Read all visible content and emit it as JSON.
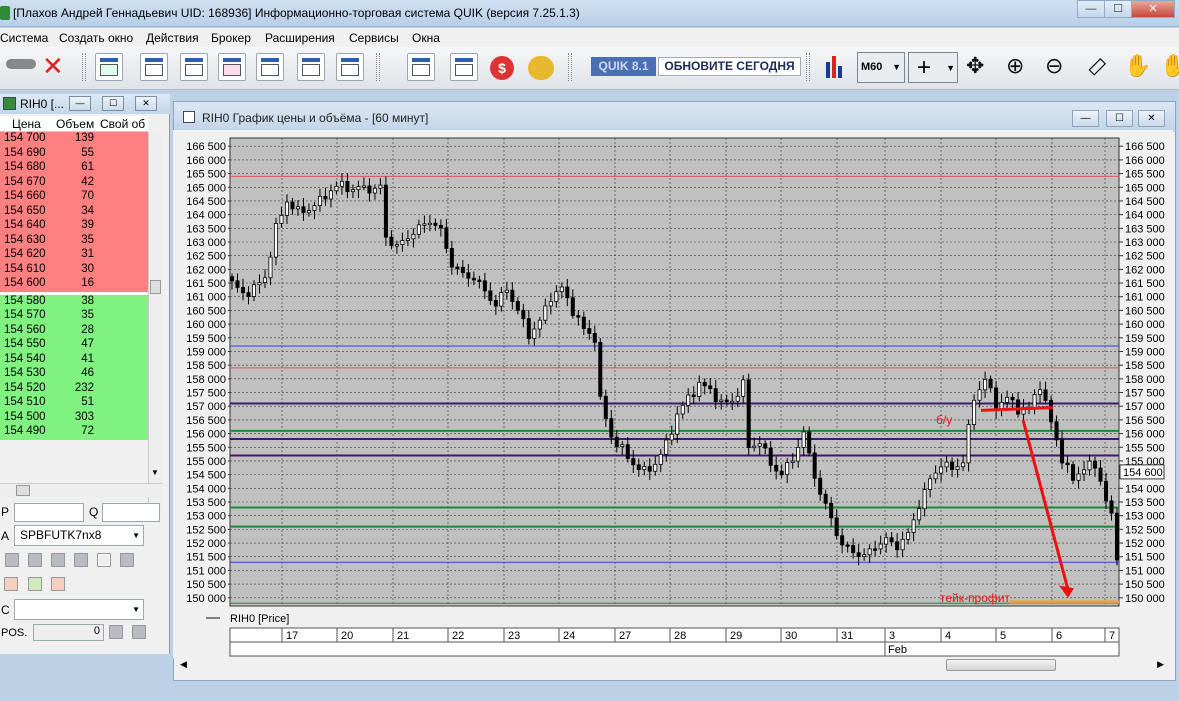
{
  "window": {
    "title": "[Плахов Андрей Геннадьевич UID: 168936] Информационно-торговая система QUIK (версия 7.25.1.3)",
    "controls": [
      "—",
      "☐",
      "✕"
    ]
  },
  "menu": [
    "Система",
    "Создать окно",
    "Действия",
    "Брокер",
    "Расширения",
    "Сервисы",
    "Окна"
  ],
  "toolbar": {
    "badge": "QUIK 8.1",
    "update_text": "ОБНОВИТЕ СЕГОДНЯ",
    "interval": "M60"
  },
  "orderbook": {
    "title": "RIH0 [...",
    "columns": [
      "Цена",
      "Объем",
      "Свой об"
    ],
    "sell": [
      [
        "154 700",
        "139"
      ],
      [
        "154 690",
        "55"
      ],
      [
        "154 680",
        "61"
      ],
      [
        "154 670",
        "42"
      ],
      [
        "154 660",
        "70"
      ],
      [
        "154 650",
        "34"
      ],
      [
        "154 640",
        "39"
      ],
      [
        "154 630",
        "35"
      ],
      [
        "154 620",
        "31"
      ],
      [
        "154 610",
        "30"
      ],
      [
        "154 600",
        "16"
      ]
    ],
    "buy": [
      [
        "154 580",
        "38"
      ],
      [
        "154 570",
        "35"
      ],
      [
        "154 560",
        "28"
      ],
      [
        "154 550",
        "47"
      ],
      [
        "154 540",
        "41"
      ],
      [
        "154 530",
        "46"
      ],
      [
        "154 520",
        "232"
      ],
      [
        "154 510",
        "51"
      ],
      [
        "154 500",
        "303"
      ],
      [
        "154 490",
        "72"
      ]
    ],
    "label_p": "P",
    "label_q": "Q",
    "label_a": "A",
    "account": "SPBFUTK7nx8",
    "label_c": "C",
    "label_pos": "POS.",
    "pos_value": "0"
  },
  "chart_window": {
    "title": "RIH0 График цены и объёма - [60 минут]",
    "legend": "RIH0 [Price]",
    "month_label": "Feb",
    "current_price": "154 600",
    "annotation_be": "б/у",
    "annotation_tp": "тейк-профит"
  },
  "chart_data": {
    "type": "candlestick",
    "ylim": [
      149700,
      166800
    ],
    "y_ticks": [
      150000,
      150500,
      151000,
      151500,
      152000,
      152500,
      153000,
      153500,
      154000,
      154500,
      155000,
      155500,
      156000,
      156500,
      157000,
      157500,
      158000,
      158500,
      159000,
      159500,
      160000,
      160500,
      161000,
      161500,
      162000,
      162500,
      163000,
      163500,
      164000,
      164500,
      165000,
      165500,
      166000,
      166500
    ],
    "x_labels": [
      "17",
      "20",
      "21",
      "22",
      "23",
      "24",
      "27",
      "28",
      "29",
      "30",
      "31",
      "3",
      "4",
      "5",
      "6",
      "7"
    ],
    "close_path": [
      [
        0,
        161500
      ],
      [
        2,
        161100
      ],
      [
        4,
        161300
      ],
      [
        6,
        161700
      ],
      [
        8,
        163500
      ],
      [
        10,
        164500
      ],
      [
        12,
        164100
      ],
      [
        14,
        164200
      ],
      [
        16,
        164500
      ],
      [
        18,
        164900
      ],
      [
        20,
        165100
      ],
      [
        22,
        164900
      ],
      [
        24,
        165000
      ],
      [
        26,
        164900
      ],
      [
        27,
        165000
      ],
      [
        28,
        163200
      ],
      [
        30,
        162800
      ],
      [
        32,
        163200
      ],
      [
        34,
        163500
      ],
      [
        36,
        163800
      ],
      [
        38,
        163400
      ],
      [
        40,
        162200
      ],
      [
        42,
        161800
      ],
      [
        44,
        161700
      ],
      [
        46,
        161200
      ],
      [
        48,
        160700
      ],
      [
        50,
        161300
      ],
      [
        52,
        160500
      ],
      [
        54,
        159600
      ],
      [
        56,
        160100
      ],
      [
        58,
        161000
      ],
      [
        60,
        161300
      ],
      [
        62,
        160500
      ],
      [
        64,
        159800
      ],
      [
        66,
        159500
      ],
      [
        67,
        157200
      ],
      [
        69,
        155900
      ],
      [
        71,
        155400
      ],
      [
        73,
        154900
      ],
      [
        75,
        154600
      ],
      [
        77,
        154900
      ],
      [
        79,
        155600
      ],
      [
        81,
        156700
      ],
      [
        83,
        157300
      ],
      [
        85,
        157800
      ],
      [
        87,
        157600
      ],
      [
        89,
        157100
      ],
      [
        91,
        157200
      ],
      [
        93,
        157800
      ],
      [
        94,
        155500
      ],
      [
        96,
        155700
      ],
      [
        98,
        154900
      ],
      [
        100,
        154500
      ],
      [
        102,
        155100
      ],
      [
        104,
        156000
      ],
      [
        105,
        155200
      ],
      [
        107,
        153800
      ],
      [
        109,
        152900
      ],
      [
        111,
        151900
      ],
      [
        113,
        151700
      ],
      [
        115,
        151500
      ],
      [
        117,
        151900
      ],
      [
        119,
        152100
      ],
      [
        121,
        151900
      ],
      [
        123,
        152300
      ],
      [
        125,
        153400
      ],
      [
        127,
        154300
      ],
      [
        129,
        154900
      ],
      [
        131,
        154700
      ],
      [
        133,
        155000
      ],
      [
        135,
        157300
      ],
      [
        137,
        158000
      ],
      [
        139,
        157000
      ],
      [
        141,
        157300
      ],
      [
        143,
        156900
      ],
      [
        145,
        156900
      ],
      [
        147,
        157800
      ],
      [
        149,
        156400
      ],
      [
        151,
        155100
      ],
      [
        153,
        154300
      ],
      [
        155,
        154800
      ],
      [
        157,
        154800
      ],
      [
        158,
        154300
      ],
      [
        160,
        152900
      ],
      [
        161,
        151500
      ]
    ],
    "levels": [
      {
        "price": 165400,
        "color": "#e05555",
        "width": 1
      },
      {
        "price": 159200,
        "color": "#3a3aee",
        "width": 1
      },
      {
        "price": 158400,
        "color": "#e05555",
        "width": 1
      },
      {
        "price": 157100,
        "color": "#3a1a70",
        "width": 2
      },
      {
        "price": 156100,
        "color": "#1a8a3a",
        "width": 2
      },
      {
        "price": 155800,
        "color": "#3a1a70",
        "width": 2
      },
      {
        "price": 155200,
        "color": "#3a1a70",
        "width": 2
      },
      {
        "price": 153300,
        "color": "#1a8a3a",
        "width": 2
      },
      {
        "price": 152600,
        "color": "#1a8a3a",
        "width": 2
      },
      {
        "price": 151300,
        "color": "#3a3aee",
        "width": 1
      },
      {
        "price": 149800,
        "color": "#1a8a3a",
        "width": 1
      }
    ],
    "colors": {
      "plot_bg": "#c0c0c0",
      "candle": "#000000",
      "annotation": "#ee1111",
      "take_profit_line": "#e8a040"
    }
  }
}
